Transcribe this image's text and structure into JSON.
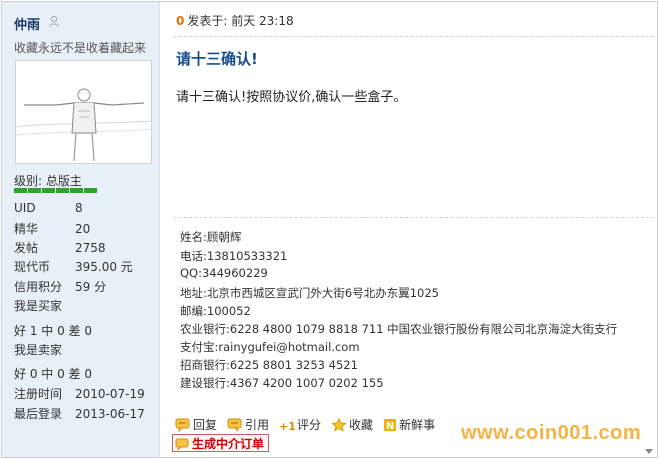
{
  "user": {
    "name": "仲雨",
    "signature": "收藏永远不是收着藏起来",
    "level_label": "级别: 总版主",
    "stats": [
      {
        "key": "UID",
        "value": "8"
      },
      {
        "key": "精华",
        "value": "20"
      },
      {
        "key": "发帖",
        "value": "2758"
      },
      {
        "key": "现代币",
        "value": "395.00 元"
      },
      {
        "key": "信用积分",
        "value": "59 分"
      },
      {
        "key": "我是买家",
        "value": ""
      },
      {
        "key": "好 1 中 0 差 0",
        "value": ""
      },
      {
        "key": "我是卖家",
        "value": ""
      },
      {
        "key": "好 0 中 0 差 0",
        "value": ""
      },
      {
        "key": "注册时间",
        "value": "2010-07-19"
      },
      {
        "key": "最后登录",
        "value": "2013-06-17"
      }
    ]
  },
  "post": {
    "floor": "0",
    "posted_label": "发表于: 前天  23:18",
    "title": "请十三确认!",
    "body": "请十三确认!按照协议价,确认一些盒子。"
  },
  "signature_lines": [
    "姓名:顾朝辉",
    "电话:13810533321",
    "QQ:344960229",
    "地址:北京市西城区宣武门外大街6号北办东翼1025",
    "邮编:100052",
    "农业银行:6228 4800 1079 8818 711 中国农业银行股份有限公司北京海淀大街支行",
    "支付宝:rainygufei@hotmail.com",
    "招商银行:6225 8801 3253 4521",
    "建设银行:4367 4200 1007 0202 155"
  ],
  "actions": {
    "reply": "回复",
    "quote": "引用",
    "rate": "评分",
    "favorite": "收藏",
    "fresh": "新鲜事",
    "make_order": "生成中介订单"
  },
  "watermark": "www.coin001.com",
  "colors": {
    "sidebar_bg": "#e8f0f7",
    "title": "#1a4d8c",
    "floor": "#e36c09",
    "star_green": "#2fa12f",
    "order_red": "#cc0000",
    "watermark": "#f5a623"
  }
}
